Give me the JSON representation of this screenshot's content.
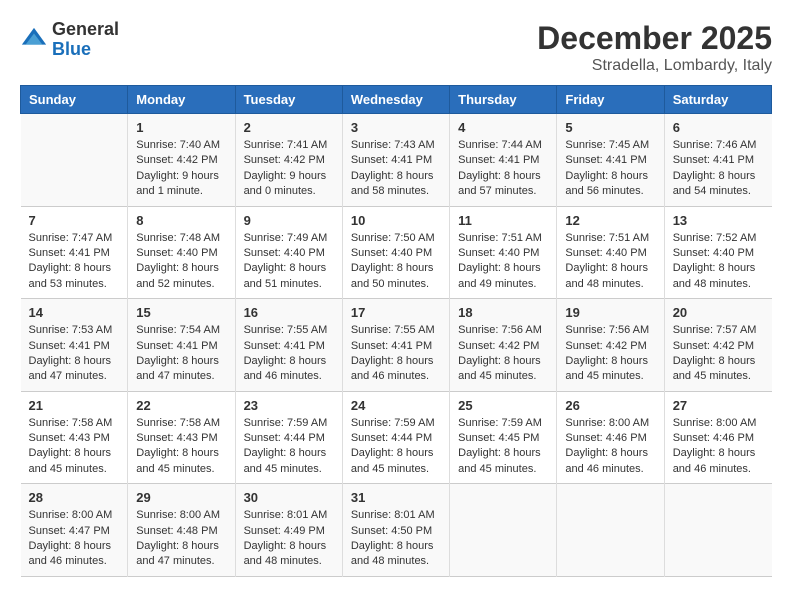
{
  "header": {
    "logo_general": "General",
    "logo_blue": "Blue",
    "month": "December 2025",
    "location": "Stradella, Lombardy, Italy"
  },
  "days_of_week": [
    "Sunday",
    "Monday",
    "Tuesday",
    "Wednesday",
    "Thursday",
    "Friday",
    "Saturday"
  ],
  "weeks": [
    [
      {
        "day": "",
        "sunrise": "",
        "sunset": "",
        "daylight": ""
      },
      {
        "day": "1",
        "sunrise": "Sunrise: 7:40 AM",
        "sunset": "Sunset: 4:42 PM",
        "daylight": "Daylight: 9 hours and 1 minute."
      },
      {
        "day": "2",
        "sunrise": "Sunrise: 7:41 AM",
        "sunset": "Sunset: 4:42 PM",
        "daylight": "Daylight: 9 hours and 0 minutes."
      },
      {
        "day": "3",
        "sunrise": "Sunrise: 7:43 AM",
        "sunset": "Sunset: 4:41 PM",
        "daylight": "Daylight: 8 hours and 58 minutes."
      },
      {
        "day": "4",
        "sunrise": "Sunrise: 7:44 AM",
        "sunset": "Sunset: 4:41 PM",
        "daylight": "Daylight: 8 hours and 57 minutes."
      },
      {
        "day": "5",
        "sunrise": "Sunrise: 7:45 AM",
        "sunset": "Sunset: 4:41 PM",
        "daylight": "Daylight: 8 hours and 56 minutes."
      },
      {
        "day": "6",
        "sunrise": "Sunrise: 7:46 AM",
        "sunset": "Sunset: 4:41 PM",
        "daylight": "Daylight: 8 hours and 54 minutes."
      }
    ],
    [
      {
        "day": "7",
        "sunrise": "Sunrise: 7:47 AM",
        "sunset": "Sunset: 4:41 PM",
        "daylight": "Daylight: 8 hours and 53 minutes."
      },
      {
        "day": "8",
        "sunrise": "Sunrise: 7:48 AM",
        "sunset": "Sunset: 4:40 PM",
        "daylight": "Daylight: 8 hours and 52 minutes."
      },
      {
        "day": "9",
        "sunrise": "Sunrise: 7:49 AM",
        "sunset": "Sunset: 4:40 PM",
        "daylight": "Daylight: 8 hours and 51 minutes."
      },
      {
        "day": "10",
        "sunrise": "Sunrise: 7:50 AM",
        "sunset": "Sunset: 4:40 PM",
        "daylight": "Daylight: 8 hours and 50 minutes."
      },
      {
        "day": "11",
        "sunrise": "Sunrise: 7:51 AM",
        "sunset": "Sunset: 4:40 PM",
        "daylight": "Daylight: 8 hours and 49 minutes."
      },
      {
        "day": "12",
        "sunrise": "Sunrise: 7:51 AM",
        "sunset": "Sunset: 4:40 PM",
        "daylight": "Daylight: 8 hours and 48 minutes."
      },
      {
        "day": "13",
        "sunrise": "Sunrise: 7:52 AM",
        "sunset": "Sunset: 4:40 PM",
        "daylight": "Daylight: 8 hours and 48 minutes."
      }
    ],
    [
      {
        "day": "14",
        "sunrise": "Sunrise: 7:53 AM",
        "sunset": "Sunset: 4:41 PM",
        "daylight": "Daylight: 8 hours and 47 minutes."
      },
      {
        "day": "15",
        "sunrise": "Sunrise: 7:54 AM",
        "sunset": "Sunset: 4:41 PM",
        "daylight": "Daylight: 8 hours and 47 minutes."
      },
      {
        "day": "16",
        "sunrise": "Sunrise: 7:55 AM",
        "sunset": "Sunset: 4:41 PM",
        "daylight": "Daylight: 8 hours and 46 minutes."
      },
      {
        "day": "17",
        "sunrise": "Sunrise: 7:55 AM",
        "sunset": "Sunset: 4:41 PM",
        "daylight": "Daylight: 8 hours and 46 minutes."
      },
      {
        "day": "18",
        "sunrise": "Sunrise: 7:56 AM",
        "sunset": "Sunset: 4:42 PM",
        "daylight": "Daylight: 8 hours and 45 minutes."
      },
      {
        "day": "19",
        "sunrise": "Sunrise: 7:56 AM",
        "sunset": "Sunset: 4:42 PM",
        "daylight": "Daylight: 8 hours and 45 minutes."
      },
      {
        "day": "20",
        "sunrise": "Sunrise: 7:57 AM",
        "sunset": "Sunset: 4:42 PM",
        "daylight": "Daylight: 8 hours and 45 minutes."
      }
    ],
    [
      {
        "day": "21",
        "sunrise": "Sunrise: 7:58 AM",
        "sunset": "Sunset: 4:43 PM",
        "daylight": "Daylight: 8 hours and 45 minutes."
      },
      {
        "day": "22",
        "sunrise": "Sunrise: 7:58 AM",
        "sunset": "Sunset: 4:43 PM",
        "daylight": "Daylight: 8 hours and 45 minutes."
      },
      {
        "day": "23",
        "sunrise": "Sunrise: 7:59 AM",
        "sunset": "Sunset: 4:44 PM",
        "daylight": "Daylight: 8 hours and 45 minutes."
      },
      {
        "day": "24",
        "sunrise": "Sunrise: 7:59 AM",
        "sunset": "Sunset: 4:44 PM",
        "daylight": "Daylight: 8 hours and 45 minutes."
      },
      {
        "day": "25",
        "sunrise": "Sunrise: 7:59 AM",
        "sunset": "Sunset: 4:45 PM",
        "daylight": "Daylight: 8 hours and 45 minutes."
      },
      {
        "day": "26",
        "sunrise": "Sunrise: 8:00 AM",
        "sunset": "Sunset: 4:46 PM",
        "daylight": "Daylight: 8 hours and 46 minutes."
      },
      {
        "day": "27",
        "sunrise": "Sunrise: 8:00 AM",
        "sunset": "Sunset: 4:46 PM",
        "daylight": "Daylight: 8 hours and 46 minutes."
      }
    ],
    [
      {
        "day": "28",
        "sunrise": "Sunrise: 8:00 AM",
        "sunset": "Sunset: 4:47 PM",
        "daylight": "Daylight: 8 hours and 46 minutes."
      },
      {
        "day": "29",
        "sunrise": "Sunrise: 8:00 AM",
        "sunset": "Sunset: 4:48 PM",
        "daylight": "Daylight: 8 hours and 47 minutes."
      },
      {
        "day": "30",
        "sunrise": "Sunrise: 8:01 AM",
        "sunset": "Sunset: 4:49 PM",
        "daylight": "Daylight: 8 hours and 48 minutes."
      },
      {
        "day": "31",
        "sunrise": "Sunrise: 8:01 AM",
        "sunset": "Sunset: 4:50 PM",
        "daylight": "Daylight: 8 hours and 48 minutes."
      },
      {
        "day": "",
        "sunrise": "",
        "sunset": "",
        "daylight": ""
      },
      {
        "day": "",
        "sunrise": "",
        "sunset": "",
        "daylight": ""
      },
      {
        "day": "",
        "sunrise": "",
        "sunset": "",
        "daylight": ""
      }
    ]
  ]
}
